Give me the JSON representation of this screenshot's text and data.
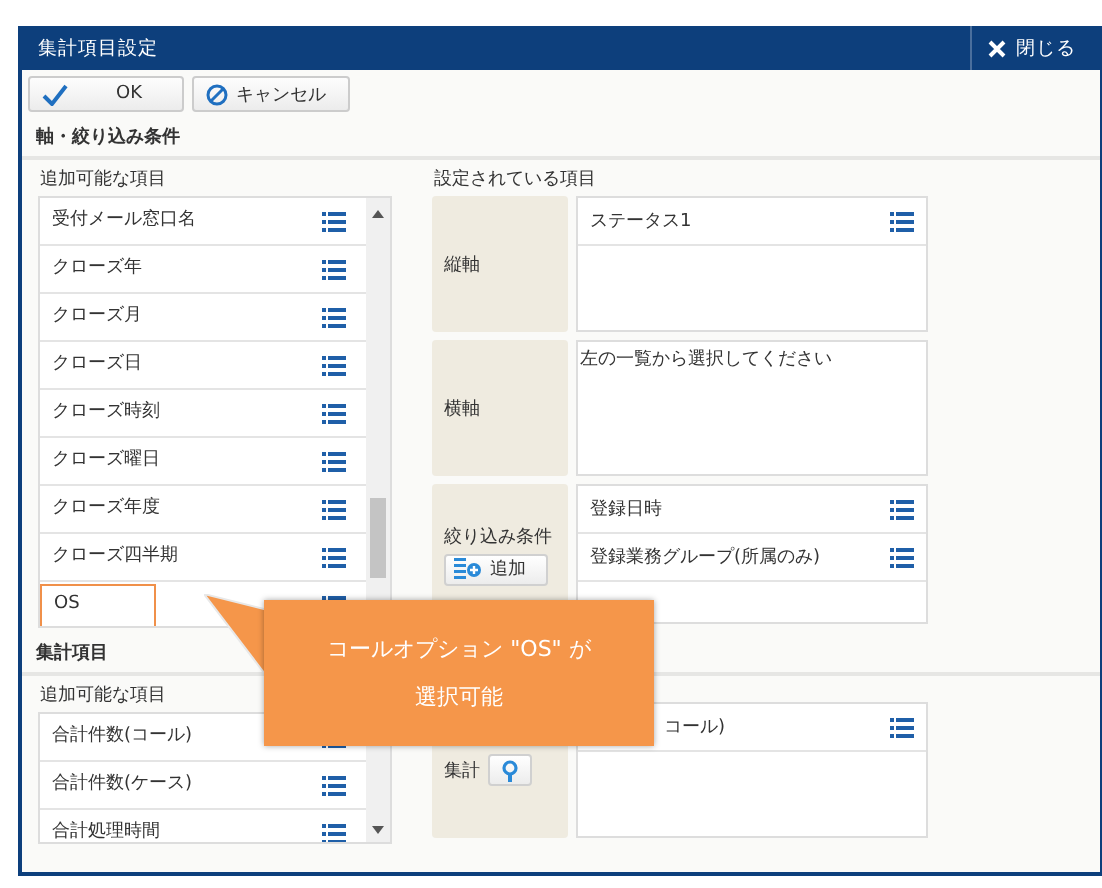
{
  "dialog": {
    "title": "集計項目設定",
    "close_label": "閉じる"
  },
  "toolbar": [
    {
      "kind": "ok",
      "label": "OK"
    },
    {
      "kind": "cancel",
      "label": "キャンセル"
    }
  ],
  "sections": [
    {
      "heading": "軸・絞り込み条件",
      "available_label": "追加可能な項目",
      "set_label": "設定されている項目",
      "available_items": [
        {
          "label": "受付メール窓口名",
          "highlighted": false
        },
        {
          "label": "クローズ年",
          "highlighted": false
        },
        {
          "label": "クローズ月",
          "highlighted": false
        },
        {
          "label": "クローズ日",
          "highlighted": false
        },
        {
          "label": "クローズ時刻",
          "highlighted": false
        },
        {
          "label": "クローズ曜日",
          "highlighted": false
        },
        {
          "label": "クローズ年度",
          "highlighted": false
        },
        {
          "label": "クローズ四半期",
          "highlighted": false
        },
        {
          "label": "OS",
          "highlighted": true
        }
      ],
      "rows": [
        {
          "kind": "plain",
          "label": "縦軸",
          "items": [
            "ステータス1"
          ]
        },
        {
          "kind": "plain",
          "label": "横軸",
          "hint": "左の一覧から選択してください"
        },
        {
          "kind": "add",
          "label": "絞り込み条件",
          "button": "追加",
          "items": [
            "登録日時",
            "登録業務グループ(所属のみ)"
          ]
        }
      ]
    },
    {
      "heading": "集計項目",
      "available_label": "追加可能な項目",
      "available_items": [
        {
          "label": "合計件数(コール)",
          "highlighted": false
        },
        {
          "label": "合計件数(ケース)",
          "highlighted": false
        },
        {
          "label": "合計処理時間",
          "highlighted": false
        }
      ],
      "rows": [
        {
          "kind": "bulb",
          "label": "集計",
          "items": [
            "コール)"
          ]
        }
      ]
    }
  ],
  "callout": {
    "lines": [
      "コールオプション \"OS\" が",
      "選択可能"
    ]
  }
}
